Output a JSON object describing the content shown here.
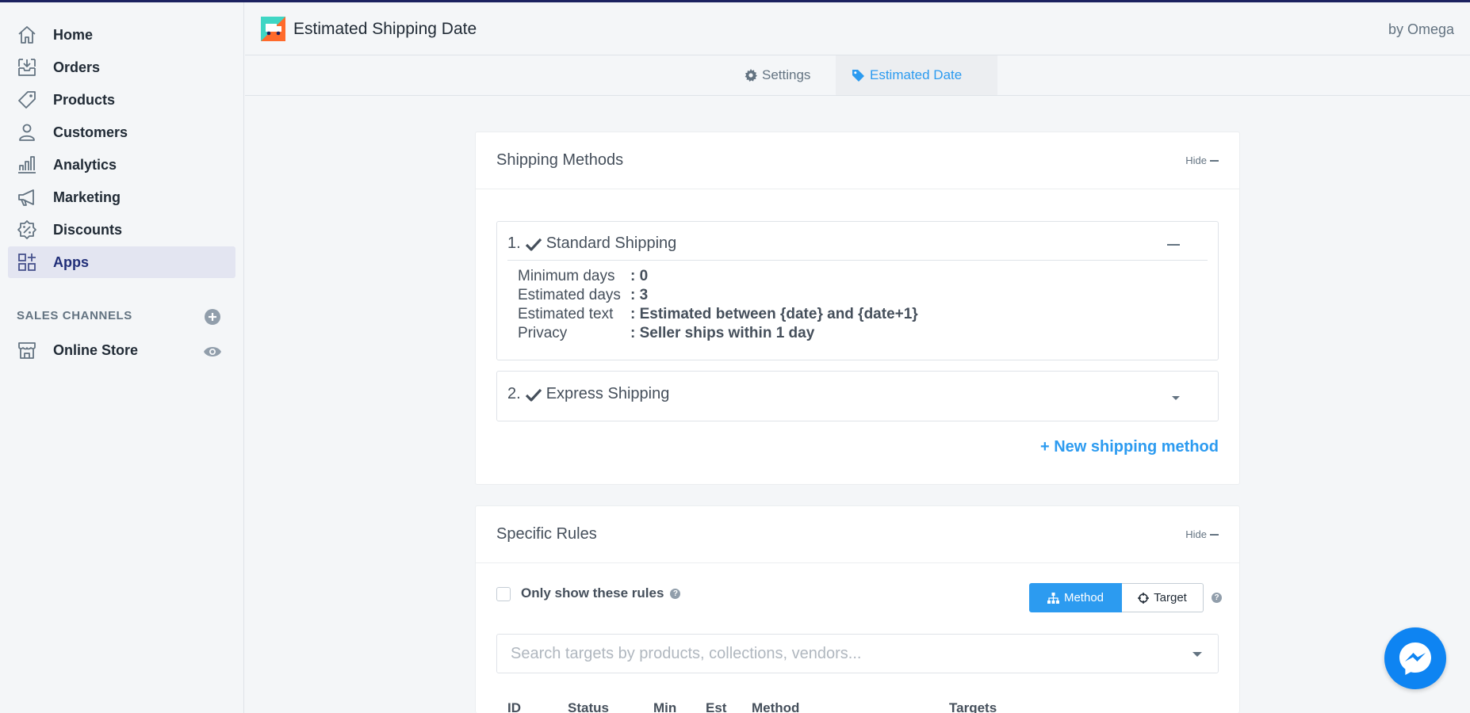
{
  "nav": {
    "items": [
      {
        "label": "Home",
        "icon": "home-icon"
      },
      {
        "label": "Orders",
        "icon": "orders-icon"
      },
      {
        "label": "Products",
        "icon": "tag-icon"
      },
      {
        "label": "Customers",
        "icon": "person-icon"
      },
      {
        "label": "Analytics",
        "icon": "bar-chart-icon"
      },
      {
        "label": "Marketing",
        "icon": "megaphone-icon"
      },
      {
        "label": "Discounts",
        "icon": "discount-icon"
      },
      {
        "label": "Apps",
        "icon": "apps-grid-icon",
        "active": true
      }
    ],
    "sales_channels_title": "SALES CHANNELS",
    "online_store": "Online Store"
  },
  "header": {
    "app_title": "Estimated Shipping Date",
    "by": "by Omega"
  },
  "tabs": {
    "settings": "Settings",
    "estimated_date": "Estimated Date"
  },
  "shipping_methods": {
    "title": "Shipping Methods",
    "hide_label": "Hide",
    "methods": [
      {
        "number": "1.",
        "name": "Standard Shipping",
        "expanded": true,
        "details": [
          {
            "key": "Minimum days",
            "value": ": 0"
          },
          {
            "key": "Estimated days",
            "value": ": 3"
          },
          {
            "key": "Estimated text",
            "value": ": Estimated between {date} and {date+1}"
          },
          {
            "key": "Privacy",
            "value": ": Seller ships within 1 day"
          }
        ]
      },
      {
        "number": "2.",
        "name": "Express Shipping",
        "expanded": false
      }
    ],
    "new_method": "+ New shipping method"
  },
  "specific_rules": {
    "title": "Specific Rules",
    "hide_label": "Hide",
    "only_show_label": "Only show these rules",
    "toggle": {
      "method": "Method",
      "target": "Target",
      "selected": "Method"
    },
    "search_placeholder": "Search targets by products, collections, vendors...",
    "columns": [
      "ID",
      "Status",
      "Min",
      "Est",
      "Method",
      "Targets"
    ]
  },
  "colors": {
    "accent": "#2c9bf0",
    "nav_active_bg": "#e3e5f1",
    "nav_active_text": "#202e78",
    "messenger": "#0e84f2"
  }
}
